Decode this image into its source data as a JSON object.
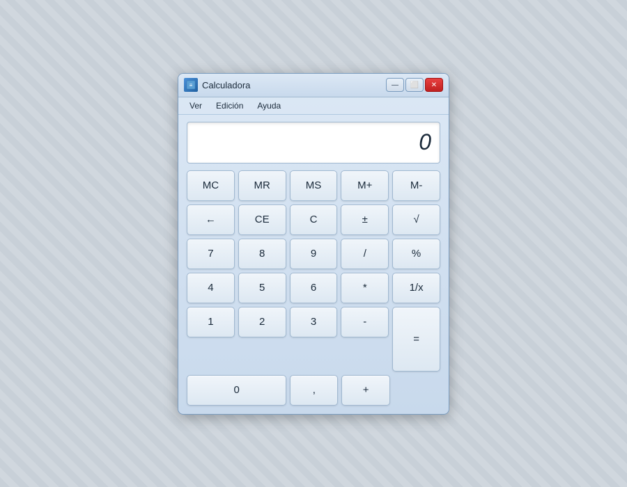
{
  "window": {
    "title": "Calculadora",
    "icon_text": "🖩"
  },
  "titleButtons": {
    "minimize": "—",
    "maximize": "⬜",
    "close": "✕"
  },
  "menuBar": {
    "items": [
      "Ver",
      "Edición",
      "Ayuda"
    ]
  },
  "display": {
    "value": "0"
  },
  "buttons": {
    "row1": [
      "MC",
      "MR",
      "MS",
      "M+",
      "M-"
    ],
    "row2": [
      "←",
      "CE",
      "C",
      "±",
      "√"
    ],
    "row3": [
      "7",
      "8",
      "9",
      "/",
      "%"
    ],
    "row4": [
      "4",
      "5",
      "6",
      "*",
      "1/x"
    ],
    "row5": [
      "1",
      "2",
      "3",
      "-",
      "="
    ],
    "row6_left": [
      "0",
      ",",
      "+"
    ]
  }
}
